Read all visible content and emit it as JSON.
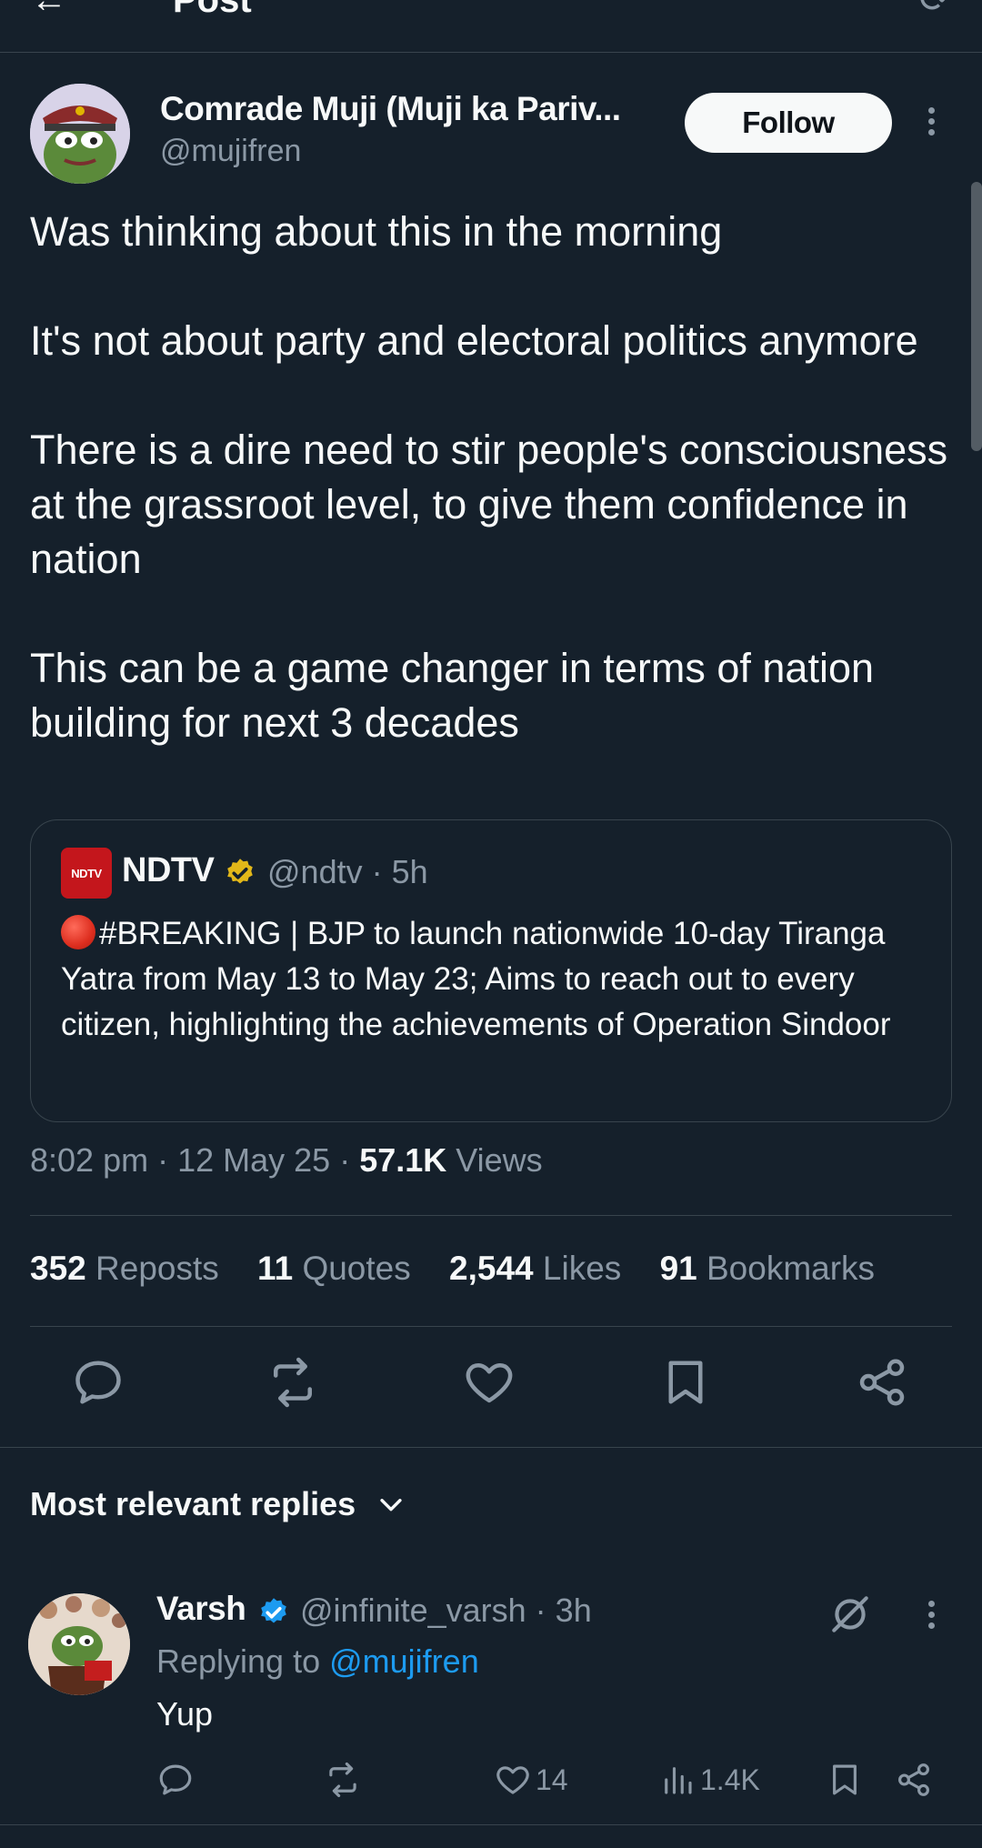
{
  "topbar": {
    "back_glyph": "←",
    "title": "Post",
    "refresh_icon": "refresh-icon"
  },
  "post": {
    "author_name": "Comrade Muji (Muji ka Pariv...",
    "author_handle": "@mujifren",
    "follow_label": "Follow",
    "paragraphs": [
      "Was thinking about this in the morning",
      "It's not about party and electoral politics anymore",
      "There is a dire need to stir people's consciousness at the grassroot level, to give them confidence in nation",
      "This can be a game changer in terms of nation building for next 3 decades"
    ],
    "quote": {
      "logo_text": "NDTV",
      "name": "NDTV",
      "handle": "@ndtv",
      "time": "5h",
      "text": "#BREAKING | BJP to launch nationwide 10-day Tiranga Yatra from May 13 to May 23; Aims to reach out to every citizen, highlighting the achievements of Operation Sindoor"
    },
    "time": "8:02 pm",
    "date": "12 May 25",
    "views_count": "57.1K",
    "views_label": "Views",
    "stats": {
      "reposts_count": "352",
      "reposts_label": "Reposts",
      "quotes_count": "11",
      "quotes_label": "Quotes",
      "likes_count": "2,544",
      "likes_label": "Likes",
      "bookmarks_count": "91",
      "bookmarks_label": "Bookmarks"
    }
  },
  "replies_section": {
    "title": "Most relevant replies"
  },
  "reply": {
    "name": "Varsh",
    "handle": "@infinite_varsh",
    "time": "3h",
    "replying_to_label": "Replying to",
    "replying_to_handle": "@mujifren",
    "text": "Yup",
    "likes": "14",
    "views": "1.4K"
  },
  "colors": {
    "background": "#15202b",
    "accent": "#1d9bf0",
    "muted": "#8b98a5",
    "verified_gold": "#e2b719"
  }
}
